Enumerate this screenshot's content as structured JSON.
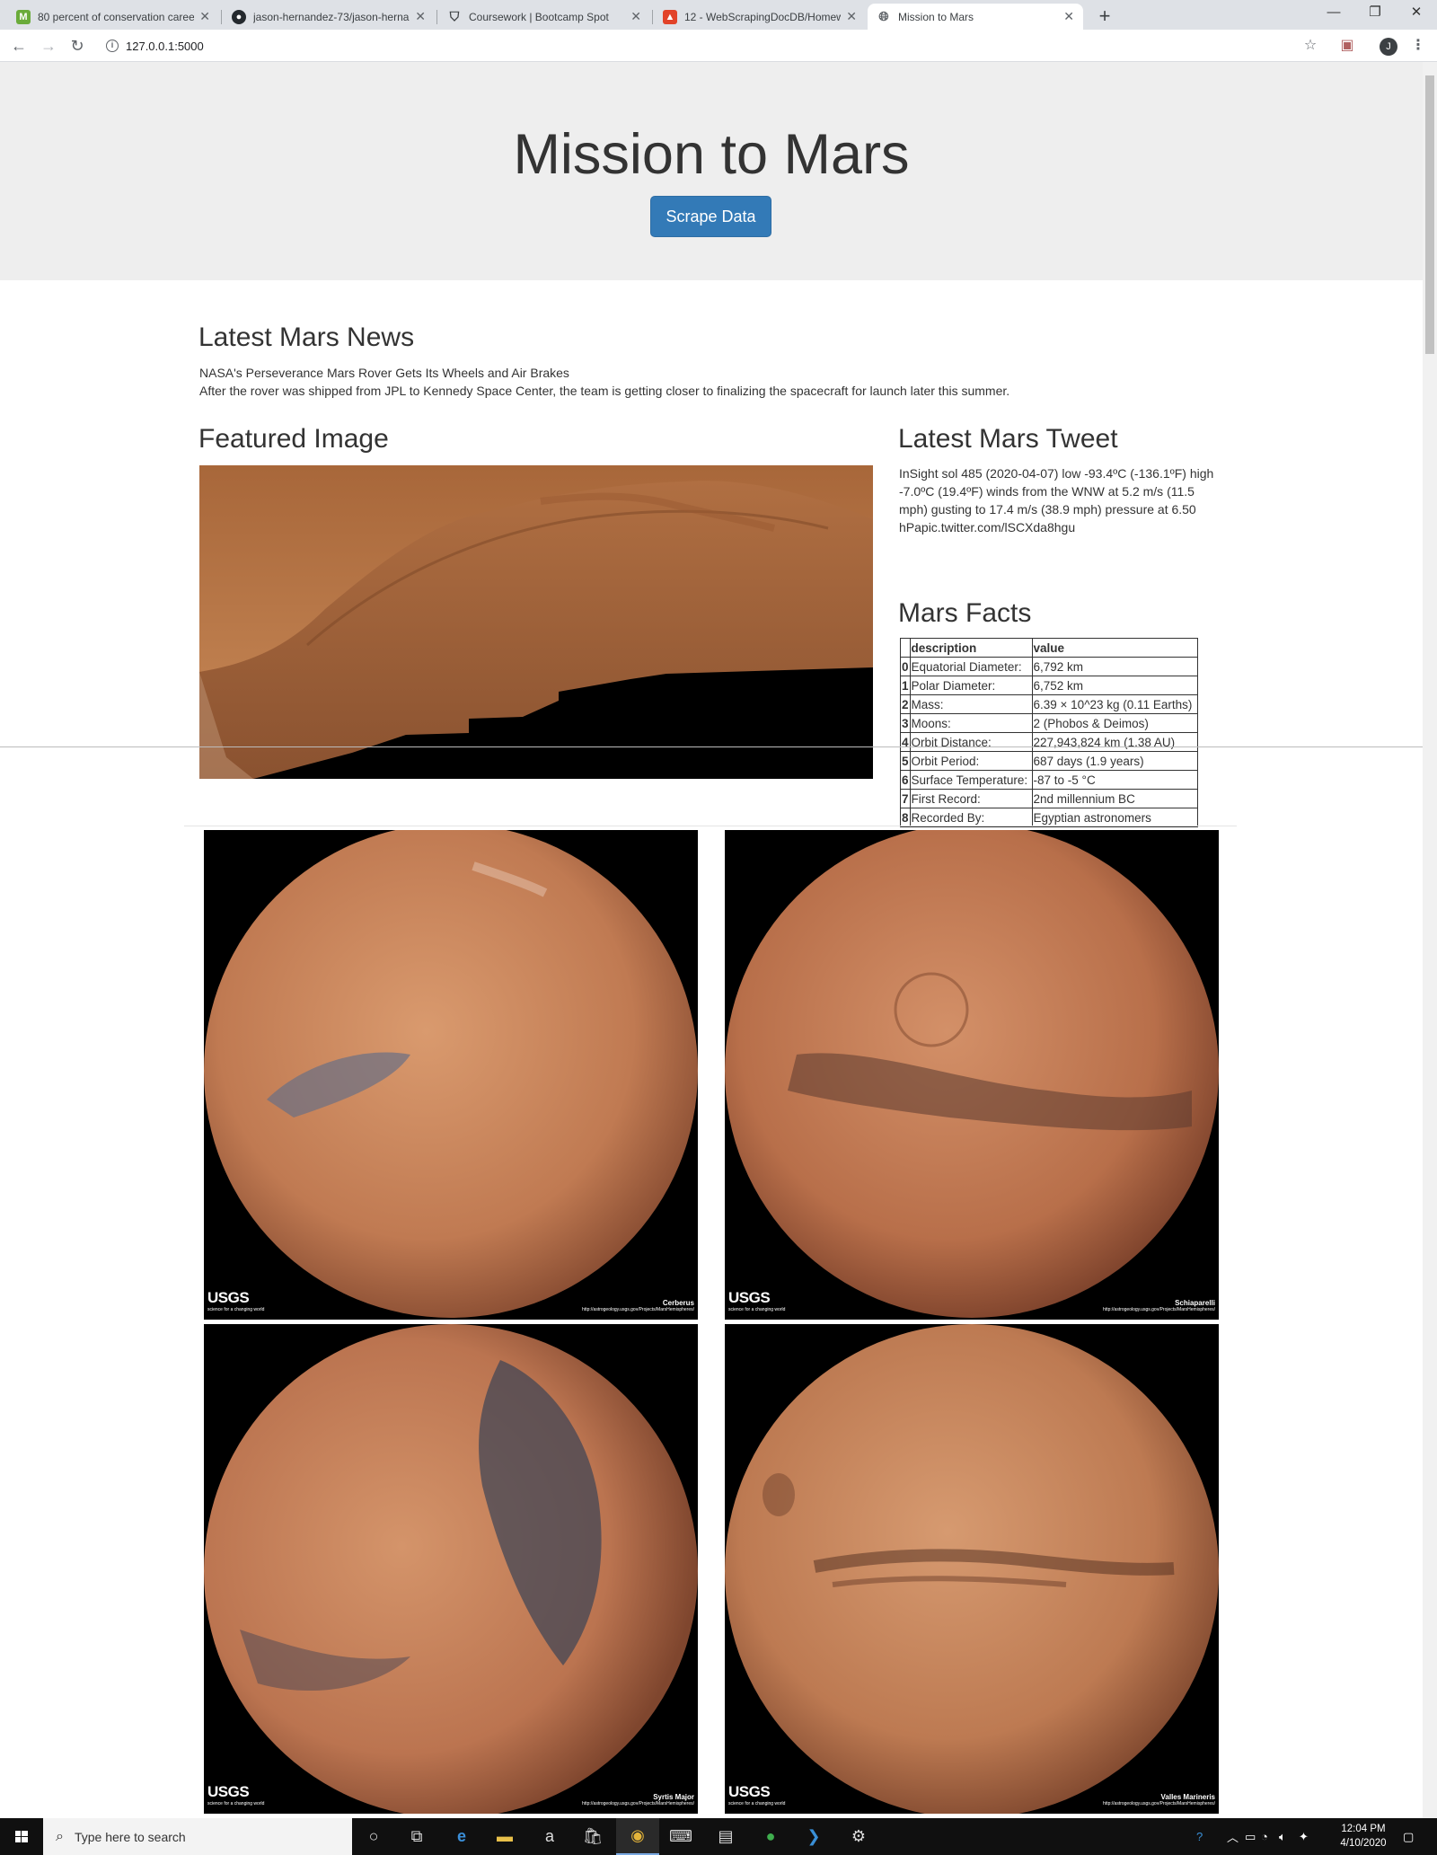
{
  "browser": {
    "tabs": [
      {
        "title": "80 percent of conservation caree",
        "icon": "medium-icon"
      },
      {
        "title": "jason-hernandez-73/jason-herna",
        "icon": "github-icon"
      },
      {
        "title": "Coursework | Bootcamp Spot",
        "icon": "shield-icon"
      },
      {
        "title": "12 - WebScrapingDocDB/Homew",
        "icon": "gitlab-icon"
      },
      {
        "title": "Mission to Mars",
        "icon": "globe-icon"
      }
    ],
    "active_tab_index": 4,
    "url": "127.0.0.1:5000",
    "profile_initial": "J"
  },
  "page": {
    "title": "Mission to Mars",
    "scrape_button": "Scrape Data",
    "news_heading": "Latest Mars News",
    "news_title": "NASA's Perseverance Mars Rover Gets Its Wheels and Air Brakes",
    "news_paragraph": "After the rover was shipped from JPL to Kennedy Space Center, the team is getting closer to finalizing the spacecraft for launch later this summer.",
    "featured_heading": "Featured Image",
    "tweet_heading": "Latest Mars Tweet",
    "tweet_text": "InSight sol 485 (2020-04-07) low -93.4ºC (-136.1ºF) high -7.0ºC (19.4ºF) winds from the WNW at 5.2 m/s (11.5 mph) gusting to 17.4 m/s (38.9 mph) pressure at 6.50 hPapic.twitter.com/lSCXda8hgu",
    "facts_heading": "Mars Facts",
    "facts_columns": [
      "",
      "description",
      "value"
    ],
    "facts_rows": [
      [
        "0",
        "Equatorial Diameter:",
        "6,792 km"
      ],
      [
        "1",
        "Polar Diameter:",
        "6,752 km"
      ],
      [
        "2",
        "Mass:",
        "6.39 × 10^23 kg (0.11 Earths)"
      ],
      [
        "3",
        "Moons:",
        "2 (Phobos & Deimos)"
      ],
      [
        "4",
        "Orbit Distance:",
        "227,943,824 km (1.38 AU)"
      ],
      [
        "5",
        "Orbit Period:",
        "687 days (1.9 years)"
      ],
      [
        "6",
        "Surface Temperature:",
        "-87 to -5 °C"
      ],
      [
        "7",
        "First Record:",
        "2nd millennium BC"
      ],
      [
        "8",
        "Recorded By:",
        "Egyptian astronomers"
      ]
    ],
    "hemispheres": [
      {
        "name": "Cerberus",
        "url": "http://astrogeology.usgs.gov/Projects/MarsHemispheres/",
        "logo": "USGS",
        "tagline": "science for a changing world"
      },
      {
        "name": "Schiaparelli",
        "url": "http://astrogeology.usgs.gov/Projects/MarsHemispheres/",
        "logo": "USGS",
        "tagline": "science for a changing world"
      },
      {
        "name": "Syrtis Major",
        "url": "http://astrogeology.usgs.gov/Projects/MarsHemispheres/",
        "logo": "USGS",
        "tagline": "science for a changing world"
      },
      {
        "name": "Valles Marineris",
        "url": "http://astrogeology.usgs.gov/Projects/MarsHemispheres/",
        "logo": "USGS",
        "tagline": "science for a changing world"
      }
    ]
  },
  "taskbar": {
    "search_placeholder": "Type here to search",
    "time": "12:04 PM",
    "date": "4/10/2020"
  },
  "colors": {
    "jumbotron_bg": "#eeeeee",
    "button_primary": "#337ab7",
    "mars_orange": "#c0714a"
  }
}
